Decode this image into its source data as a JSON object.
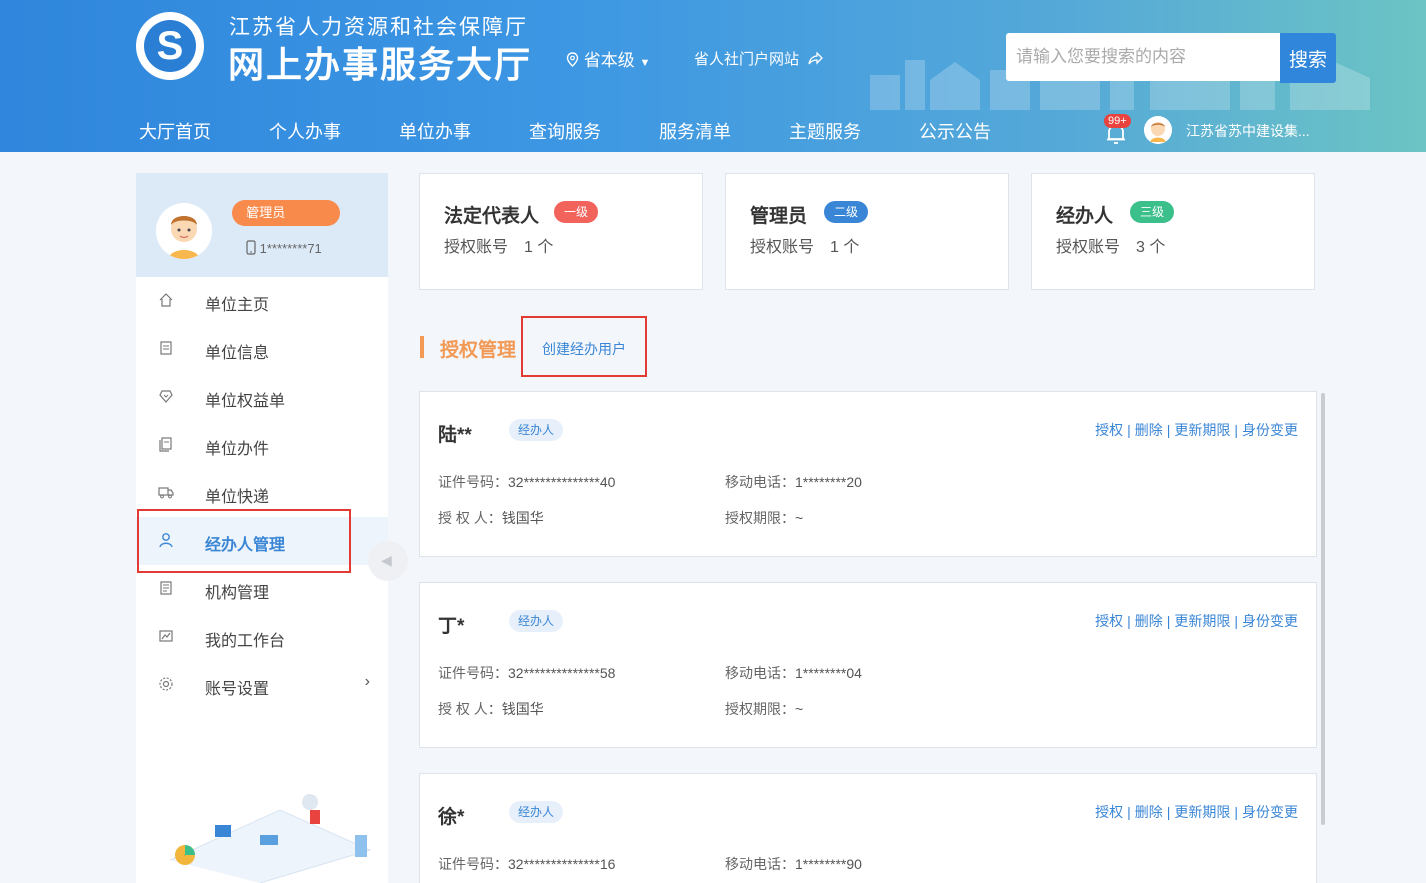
{
  "header": {
    "logo_icon": "jiangsu-hrss-logo-icon",
    "subtitle": "江苏省人力资源和社会保障厅",
    "title": "网上办事服务大厅",
    "region": "省本级",
    "portal_link": "省人社门户网站",
    "search": {
      "placeholder": "请输入您要搜索的内容",
      "button": "搜索"
    },
    "nav": [
      "大厅首页",
      "个人办事",
      "单位办事",
      "查询服务",
      "服务清单",
      "主题服务",
      "公示公告"
    ],
    "notification_badge": "99+",
    "user_name": "江苏省苏中建设集..."
  },
  "sidebar": {
    "role_badge": "管理员",
    "phone": "1********71",
    "menu": [
      {
        "label": "单位主页",
        "icon": "home-icon"
      },
      {
        "label": "单位信息",
        "icon": "document-icon"
      },
      {
        "label": "单位权益单",
        "icon": "heart-shield-icon"
      },
      {
        "label": "单位办件",
        "icon": "files-icon"
      },
      {
        "label": "单位快递",
        "icon": "delivery-truck-icon"
      },
      {
        "label": "经办人管理",
        "icon": "user-icon",
        "active": true
      },
      {
        "label": "机构管理",
        "icon": "org-icon"
      },
      {
        "label": "我的工作台",
        "icon": "chart-icon"
      },
      {
        "label": "账号设置",
        "icon": "gear-icon"
      }
    ],
    "settings_arrow": "›"
  },
  "levels": [
    {
      "title": "法定代表人",
      "tag": "一级",
      "count": "授权账号　1 个",
      "color": "#f2635c"
    },
    {
      "title": "管理员",
      "tag": "二级",
      "count": "授权账号　1 个",
      "color": "#3a86d6"
    },
    {
      "title": "经办人",
      "tag": "三级",
      "count": "授权账号　3 个",
      "color": "#3bbf8b"
    }
  ],
  "section": {
    "title": "授权管理",
    "create_button": "创建经办用户"
  },
  "agent_labels": {
    "id": "证件号码：",
    "mobile": "移动电话：",
    "authorizer": "授 权 人：",
    "period": "授权期限："
  },
  "actions": [
    "授权",
    "删除",
    "更新期限",
    "身份变更"
  ],
  "agents": [
    {
      "name": "陆**",
      "tag": "经办人",
      "id_no": "32**************40",
      "mobile": "1********20",
      "authorizer": "钱国华",
      "period": "~"
    },
    {
      "name": "丁*",
      "tag": "经办人",
      "id_no": "32**************58",
      "mobile": "1********04",
      "authorizer": "钱国华",
      "period": "~"
    },
    {
      "name": "徐*",
      "tag": "经办人",
      "id_no": "32**************16",
      "mobile": "1********90",
      "authorizer": "",
      "period": ""
    }
  ]
}
